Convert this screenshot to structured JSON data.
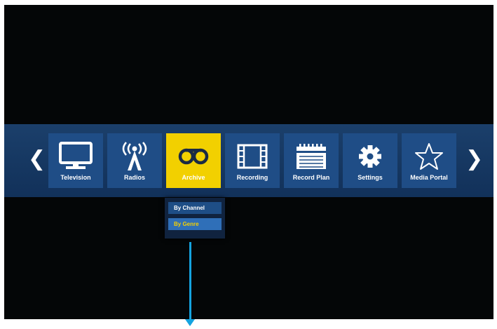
{
  "menu": {
    "items": [
      {
        "label": "Television",
        "icon": "tv-icon"
      },
      {
        "label": "Radios",
        "icon": "antenna-icon"
      },
      {
        "label": "Archive",
        "icon": "tape-reel-icon"
      },
      {
        "label": "Recording",
        "icon": "film-strip-icon"
      },
      {
        "label": "Record Plan",
        "icon": "calendar-icon"
      },
      {
        "label": "Settings",
        "icon": "gear-icon"
      },
      {
        "label": "Media Portal",
        "icon": "star-icon"
      }
    ],
    "selected": "Archive",
    "prev_arrow": "❮",
    "next_arrow": "❯"
  },
  "submenu": {
    "items": [
      {
        "label": "By Channel"
      },
      {
        "label": "By Genre"
      }
    ],
    "highlighted": "By Genre"
  },
  "colors": {
    "background": "#040607",
    "bar": "#163862",
    "tile": "#1f4d86",
    "active_tile": "#f2d000",
    "pointer": "#15a3df"
  }
}
